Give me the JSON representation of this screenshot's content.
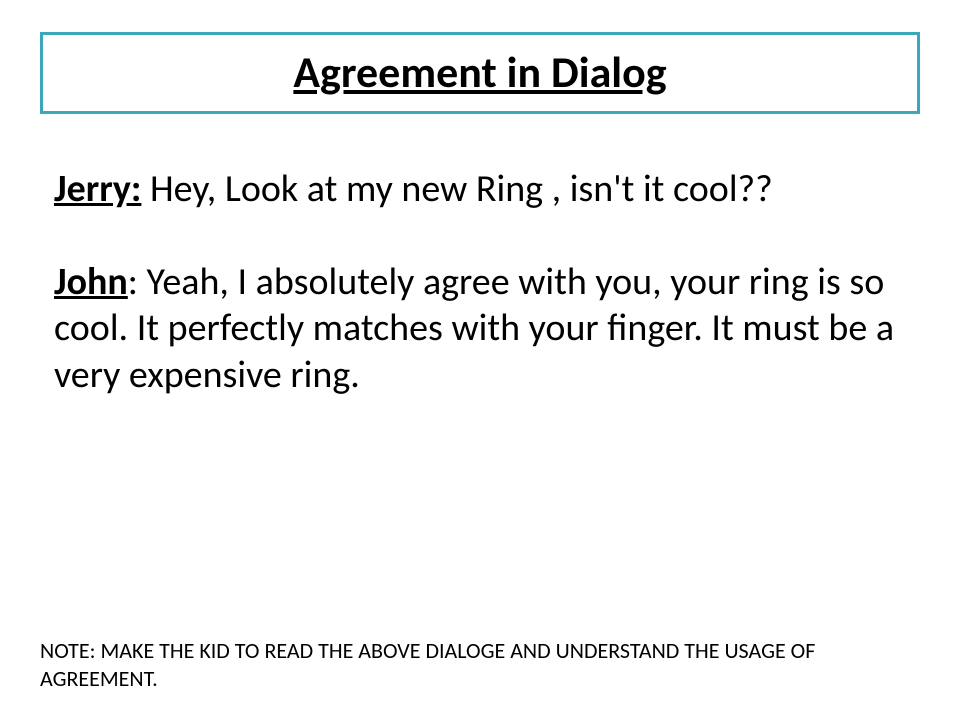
{
  "title": "Agreement in Dialog",
  "dialog": [
    {
      "speaker": "Jerry:",
      "text": " Hey, Look at my new Ring , isn't it cool??"
    },
    {
      "speaker": "John",
      "text": ": Yeah, I absolutely agree with you, your ring is so cool. It perfectly matches with your finger. It must be a very expensive ring."
    }
  ],
  "note": "NOTE: MAKE THE KID TO READ THE ABOVE DIALOGE AND UNDERSTAND THE USAGE OF AGREEMENT."
}
